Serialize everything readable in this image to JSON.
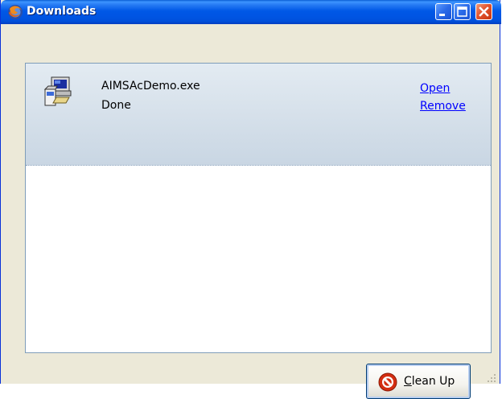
{
  "window": {
    "title": "Downloads"
  },
  "titlebar_buttons": {
    "minimize_icon": "minimize-icon",
    "maximize_icon": "maximize-icon",
    "close_icon": "close-icon"
  },
  "downloads": [
    {
      "file_name": "AIMSAcDemo.exe",
      "status": "Done",
      "icon": "installer-file-icon",
      "actions": {
        "open_label": "Open",
        "remove_label": "Remove"
      }
    }
  ],
  "footer": {
    "cleanup_accel": "C",
    "cleanup_rest": "lean Up",
    "cleanup_icon": "no-entry-icon"
  },
  "colors": {
    "titlebar": "#0054e3",
    "item_background": "#d3dee9",
    "link": "#0000ff",
    "cleanup_icon": "#d42e12"
  }
}
